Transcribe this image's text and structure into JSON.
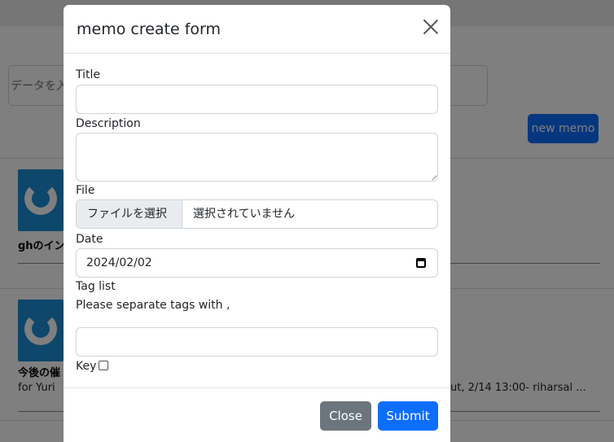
{
  "background": {
    "search_placeholder": "データを入",
    "new_memo_label": "new memo",
    "cards": [
      {
        "title": "ghのイン",
        "text": ""
      },
      {
        "title": "今後の催",
        "text": "for Yuri",
        "text_tail": "ut, 2/14 13:00- riharsal ..."
      }
    ]
  },
  "modal": {
    "title": "memo create form",
    "fields": {
      "title_label": "Title",
      "title_value": "",
      "description_label": "Description",
      "description_value": "",
      "file_label": "File",
      "file_button": "ファイルを選択",
      "file_status": "選択されていません",
      "date_label": "Date",
      "date_value": "2024/02/02",
      "tag_label": "Tag list",
      "tag_hint": "Please separate tags with ,",
      "tag_value": "",
      "key_label": "Key"
    },
    "footer": {
      "close_label": "Close",
      "submit_label": "Submit"
    }
  },
  "colors": {
    "primary": "#0d6efd",
    "secondary": "#6c757d",
    "backdrop": "rgba(0,0,0,0.5)"
  }
}
